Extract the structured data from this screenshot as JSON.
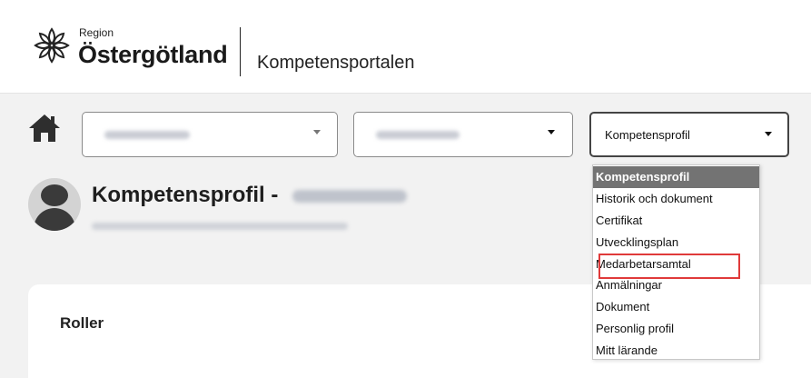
{
  "header": {
    "logo_region": "Region",
    "logo_name": "Östergötland",
    "portal_title": "Kompetensportalen"
  },
  "toolbar": {
    "home_icon": "home-icon",
    "select_1_value": "",
    "select_2_value": "",
    "select_3_value": "Kompetensprofil"
  },
  "profile": {
    "title": "Kompetensprofil -",
    "name": "",
    "subtitle": ""
  },
  "dropdown": {
    "selected_index": 0,
    "highlighted_item": "Medarbetarsamtal",
    "items": [
      {
        "label": "Kompetensprofil"
      },
      {
        "label": "Historik och dokument"
      },
      {
        "label": "Certifikat"
      },
      {
        "label": "Utvecklingsplan"
      },
      {
        "label": "Medarbetarsamtal"
      },
      {
        "label": "Anmälningar"
      },
      {
        "label": "Dokument"
      },
      {
        "label": "Personlig profil"
      },
      {
        "label": "Mitt lärande"
      }
    ]
  },
  "card": {
    "title": "Roller"
  },
  "colors": {
    "page_bg": "#f2f2f2",
    "selected_bg": "#737373",
    "highlight_border": "#e03a3a"
  }
}
